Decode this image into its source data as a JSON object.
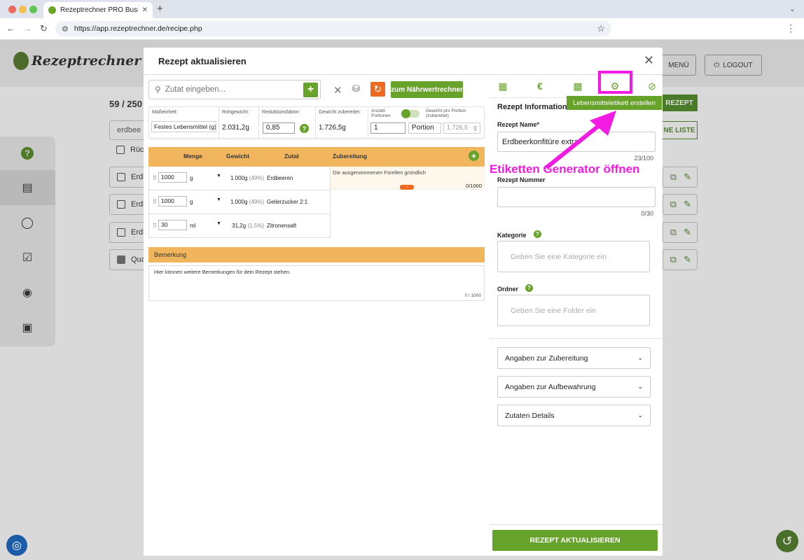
{
  "browser": {
    "tab_title": "Rezeptrechner PRO Business",
    "url": "https://app.rezeptrechner.de/recipe.php"
  },
  "app": {
    "logo_text": "Rezeptrechner",
    "menu_label": "MENÜ",
    "logout_label": "LOGOUT",
    "recipe_count": "59 / 250",
    "search_value": "erdbee",
    "new_recipe_label": "REZEPT",
    "list_label": "NE LISTE",
    "rows": [
      "Rüc",
      "Erdl",
      "Erdl",
      "Erdl",
      "Qua"
    ]
  },
  "modal": {
    "title": "Rezept aktualisieren",
    "search_placeholder": "Zutat eingeben...",
    "naehrwert_button": "zum Nährwertrechner",
    "params": {
      "masseinheit_label": "Maßeinheit:",
      "masseinheit_value": "Festes Lebensmittel (g)",
      "rohgewicht_label": "Rohgewicht:",
      "rohgewicht_value": "2.031,2g",
      "reduktion_label": "Reduktionsfaktor:",
      "reduktion_value": "0,85",
      "gewicht_zub_label": "Gewicht zubereitet:",
      "gewicht_zub_value": "1.726,5g",
      "anzahl_label_1": "Anzahl",
      "anzahl_label_2": "Portionen",
      "gewicht_portion_label_1": "Gewicht pro Portion",
      "gewicht_portion_label_2": "(zubereitet)",
      "anzahl_value": "1",
      "portion_unit": "Portion",
      "portion_weight": "1.726,5",
      "portion_weight_unit": "g"
    },
    "ingredient_headers": {
      "menge": "Menge",
      "gewicht": "Gewicht",
      "zutat": "Zutat",
      "zubereitung": "Zubereitung"
    },
    "ingredients": [
      {
        "amount": "1000",
        "unit": "g",
        "weight": "1.000g",
        "pct": "(49%)",
        "name": "Erdbeeren"
      },
      {
        "amount": "1000",
        "unit": "g",
        "weight": "1.000g",
        "pct": "(49%)",
        "name": "Gelierzucker 2:1"
      },
      {
        "amount": "30",
        "unit": "ml",
        "weight": "31,2g",
        "pct": "(1,5%)",
        "name": "Zitronensaft"
      }
    ],
    "zubereitung_text": "Die ausgenommenen Forellen gründlich",
    "zubereitung_count": "0/1000",
    "bemerkung_title": "Bemerkung",
    "bemerkung_placeholder": "Hier können weitere Bemerkungen für dein Rezept stehen.",
    "bemerkung_count": "0 / 1000",
    "right": {
      "section_title": "Rezept Informationen",
      "tooltip": "Lebensmitteletikett erstellen",
      "name_label": "Rezept Name*",
      "name_value": "Erdbeerkonfitüre extra",
      "name_count": "23/100",
      "nummer_label": "Rezept Nummer",
      "nummer_count": "0/30",
      "kategorie_label": "Kategorie",
      "kategorie_placeholder": "Geben Sie eine Kategorie ein",
      "ordner_label": "Ordner",
      "ordner_placeholder": "Geben Sie eine Folder ein",
      "dropdowns": [
        "Angaben zur Zubereitung",
        "Angaben zur Aufbewahrung",
        "Zutaten Details"
      ],
      "update_button": "REZEPT AKTUALISIEREN"
    }
  },
  "annotation": {
    "text": "Etiketten Generator öffnen",
    "color": "#f21be2"
  },
  "colors": {
    "green": "#67a22a",
    "orange": "#ee6a1f",
    "header_orange": "#f1b65d"
  }
}
